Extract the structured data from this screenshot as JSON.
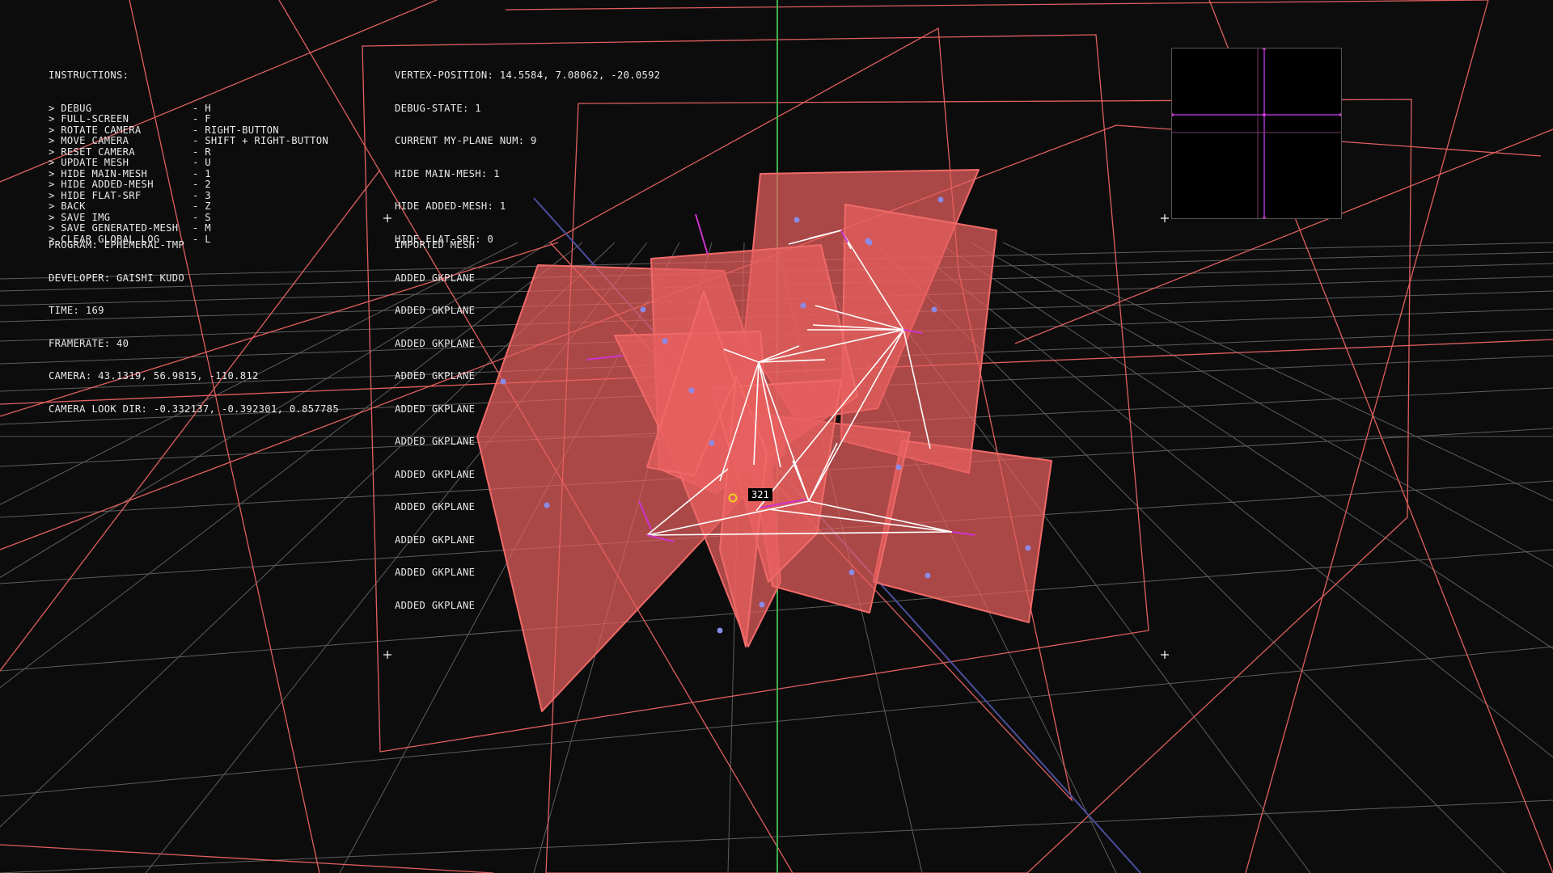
{
  "instructions": {
    "title": "INSTRUCTIONS:",
    "items": [
      {
        "action": "> DEBUG",
        "key": "- H"
      },
      {
        "action": "> FULL-SCREEN",
        "key": "- F"
      },
      {
        "action": "> ROTATE CAMERA",
        "key": "- RIGHT-BUTTON"
      },
      {
        "action": "> MOVE CAMERA",
        "key": "- SHIFT + RIGHT-BUTTON"
      },
      {
        "action": "> RESET CAMERA",
        "key": "- R"
      },
      {
        "action": "> UPDATE MESH",
        "key": "- U"
      },
      {
        "action": "> HIDE MAIN-MESH",
        "key": "- 1"
      },
      {
        "action": "> HIDE ADDED-MESH",
        "key": "- 2"
      },
      {
        "action": "> HIDE FLAT-SRF",
        "key": "- 3"
      },
      {
        "action": "> BACK",
        "key": "- Z"
      },
      {
        "action": "> SAVE IMG",
        "key": "- S"
      },
      {
        "action": "> SAVE GENERATED-MESH",
        "key": "- M"
      },
      {
        "action": "> CLEAR GLOBAL LOG",
        "key": "- L"
      }
    ]
  },
  "program_info": [
    "PROGRAM: EPHEMERAL-TMP",
    "DEVELOPER: GAISHI KUDO",
    "TIME: 169",
    "FRAMERATE: 40",
    "CAMERA: 43.1319, 56.9815, -110.812",
    "CAMERA LOOK DIR: -0.332137, -0.392301, 0.857785"
  ],
  "debug_info": [
    "VERTEX-POSITION: 14.5584, 7.08062, -20.0592",
    "DEBUG-STATE: 1",
    "CURRENT MY-PLANE NUM: 9",
    "HIDE MAIN-MESH: 1",
    "HIDE ADDED-MESH: 1",
    "HIDE FLAT-SRF: 0"
  ],
  "log": [
    "IMPORTED MESH",
    "ADDED GKPLANE",
    "ADDED GKPLANE",
    "ADDED GKPLANE",
    "ADDED GKPLANE",
    "ADDED GKPLANE",
    "ADDED GKPLANE",
    "ADDED GKPLANE",
    "ADDED GKPLANE",
    "ADDED GKPLANE",
    "ADDED GKPLANE",
    "ADDED GKPLANE"
  ],
  "vertex_label": "321",
  "colors": {
    "background": "#0c0c0d",
    "text": "#e9e9e9",
    "plane_fill": "#e8605e",
    "plane_stroke": "#f06a68",
    "wire": "#e0605e",
    "grid": "#6a6a6a",
    "y_axis": "#3fae4a",
    "z_axis": "#4a4f9c",
    "edges": "#ffffff",
    "normals": "#cc33cc",
    "markers": "#8a8ae8",
    "cursor": "#f0d020",
    "minimap_axis": "#aa33cc"
  }
}
